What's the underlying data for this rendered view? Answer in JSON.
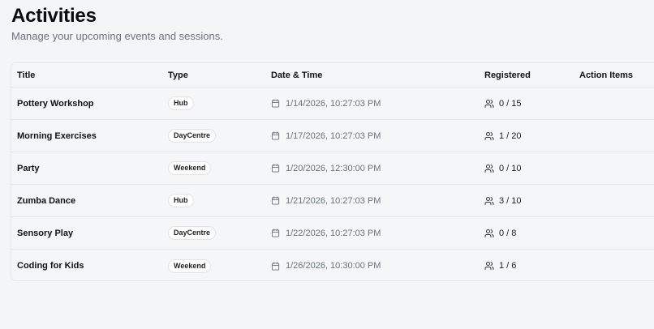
{
  "header": {
    "title": "Activities",
    "subtitle": "Manage your upcoming events and sessions."
  },
  "table": {
    "columns": [
      "Title",
      "Type",
      "Date & Time",
      "Registered",
      "Action Items"
    ],
    "rows": [
      {
        "title": "Pottery Workshop",
        "type": "Hub",
        "datetime": "1/14/2026, 10:27:03 PM",
        "registered": "0 / 15"
      },
      {
        "title": "Morning Exercises",
        "type": "DayCentre",
        "datetime": "1/17/2026, 10:27:03 PM",
        "registered": "1 / 20"
      },
      {
        "title": "Party",
        "type": "Weekend",
        "datetime": "1/20/2026, 12:30:00 PM",
        "registered": "0 / 10"
      },
      {
        "title": "Zumba Dance",
        "type": "Hub",
        "datetime": "1/21/2026, 10:27:03 PM",
        "registered": "3 / 10"
      },
      {
        "title": "Sensory Play",
        "type": "DayCentre",
        "datetime": "1/22/2026, 10:27:03 PM",
        "registered": "0 / 8"
      },
      {
        "title": "Coding for Kids",
        "type": "Weekend",
        "datetime": "1/26/2026, 10:30:00 PM",
        "registered": "1 / 6"
      }
    ]
  },
  "icons": {
    "date": "calendar-icon",
    "registered": "users-icon"
  }
}
